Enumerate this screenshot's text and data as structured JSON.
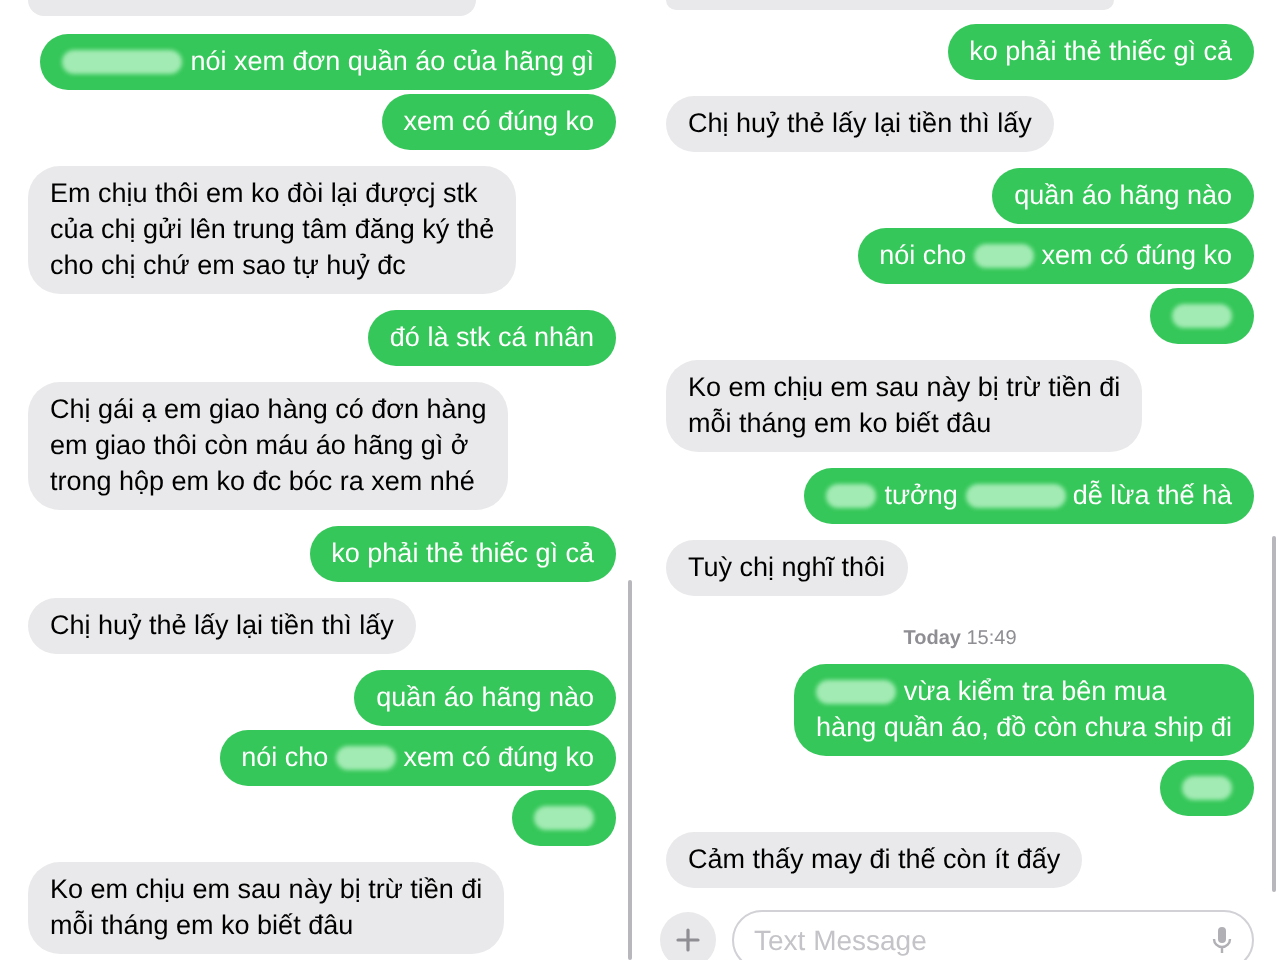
{
  "panels": [
    {
      "messages": [
        {
          "kind": "cut",
          "outgoing": false
        },
        {
          "kind": "bubble",
          "outgoing": true,
          "parts": [
            {
              "kind": "blur"
            },
            {
              "kind": "text",
              "text": "nói xem đơn quần áo của hãng gì"
            }
          ]
        },
        {
          "kind": "bubble",
          "outgoing": true,
          "parts": [
            {
              "kind": "text",
              "text": "xem có đúng ko"
            }
          ]
        },
        {
          "kind": "bubble",
          "outgoing": false,
          "parts": [
            {
              "kind": "text",
              "text": "Em chịu thôi em ko đòi lại đượcj stk\ncủa chị gửi lên trung tâm đăng ký thẻ\ncho chị chứ em sao tự huỷ đc"
            }
          ]
        },
        {
          "kind": "bubble",
          "outgoing": true,
          "parts": [
            {
              "kind": "text",
              "text": "đó là stk cá nhân"
            }
          ]
        },
        {
          "kind": "bubble",
          "outgoing": false,
          "parts": [
            {
              "kind": "text",
              "text": "Chị gái ạ em giao hàng có đơn hàng\nem giao thôi còn máu áo hãng gì ở\ntrong hộp em ko đc bóc ra xem nhé"
            }
          ]
        },
        {
          "kind": "bubble",
          "outgoing": true,
          "parts": [
            {
              "kind": "text",
              "text": "ko phải thẻ thiếc gì cả"
            }
          ]
        },
        {
          "kind": "bubble",
          "outgoing": false,
          "parts": [
            {
              "kind": "text",
              "text": "Chị huỷ thẻ lấy lại tiền thì lấy"
            }
          ]
        },
        {
          "kind": "bubble",
          "outgoing": true,
          "parts": [
            {
              "kind": "text",
              "text": "quần áo hãng nào"
            }
          ]
        },
        {
          "kind": "bubble",
          "outgoing": true,
          "parts": [
            {
              "kind": "text",
              "text": "nói cho"
            },
            {
              "kind": "blur"
            },
            {
              "kind": "text",
              "text": "xem có đúng ko"
            }
          ]
        },
        {
          "kind": "bubble",
          "outgoing": true,
          "parts": [
            {
              "kind": "blur"
            }
          ]
        },
        {
          "kind": "bubble",
          "outgoing": false,
          "parts": [
            {
              "kind": "text",
              "text": "Ko em chịu em sau này bị trừ tiền đi\nmỗi tháng em ko biết đâu"
            }
          ]
        }
      ]
    },
    {
      "messages": [
        {
          "kind": "cut",
          "outgoing": false
        },
        {
          "kind": "bubble",
          "outgoing": true,
          "parts": [
            {
              "kind": "text",
              "text": "ko phải thẻ thiếc gì cả"
            }
          ]
        },
        {
          "kind": "bubble",
          "outgoing": false,
          "parts": [
            {
              "kind": "text",
              "text": "Chị huỷ thẻ lấy lại tiền thì lấy"
            }
          ]
        },
        {
          "kind": "bubble",
          "outgoing": true,
          "parts": [
            {
              "kind": "text",
              "text": "quần áo hãng nào"
            }
          ]
        },
        {
          "kind": "bubble",
          "outgoing": true,
          "parts": [
            {
              "kind": "text",
              "text": "nói cho"
            },
            {
              "kind": "blur"
            },
            {
              "kind": "text",
              "text": "xem có đúng ko"
            }
          ]
        },
        {
          "kind": "bubble",
          "outgoing": true,
          "parts": [
            {
              "kind": "blur"
            }
          ]
        },
        {
          "kind": "bubble",
          "outgoing": false,
          "parts": [
            {
              "kind": "text",
              "text": "Ko em chịu em sau này bị trừ tiền đi\nmỗi tháng em ko biết đâu"
            }
          ]
        },
        {
          "kind": "bubble",
          "outgoing": true,
          "parts": [
            {
              "kind": "blur"
            },
            {
              "kind": "text",
              "text": "tưởng"
            },
            {
              "kind": "blur"
            },
            {
              "kind": "text",
              "text": "dễ lừa thế hà"
            }
          ]
        },
        {
          "kind": "bubble",
          "outgoing": false,
          "parts": [
            {
              "kind": "text",
              "text": "Tuỳ chị nghĩ thôi"
            }
          ]
        },
        {
          "kind": "timestamp",
          "text": "**Today** 15:49"
        },
        {
          "kind": "bubble",
          "outgoing": true,
          "parts": [
            {
              "kind": "blur"
            },
            {
              "kind": "text",
              "text": "vừa kiểm tra bên mua"
            },
            {
              "kind": "break"
            },
            {
              "kind": "text",
              "text": "hàng quần áo, đồ còn chưa ship đi"
            }
          ]
        },
        {
          "kind": "bubble",
          "outgoing": true,
          "parts": [
            {
              "kind": "blur"
            }
          ]
        },
        {
          "kind": "bubble",
          "outgoing": false,
          "parts": [
            {
              "kind": "text",
              "text": "Cảm thấy may đi thế còn ít đấy"
            }
          ]
        }
      ],
      "composer": {
        "placeholder": "Text Message"
      }
    }
  ]
}
